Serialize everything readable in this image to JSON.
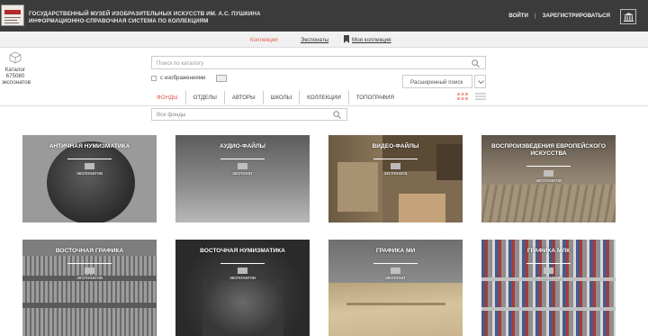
{
  "header": {
    "title_line1": "ГОСУДАРСТВЕННЫЙ МУЗЕЙ ИЗОБРАЗИТЕЛЬНЫХ ИСКУССТВ ИМ. А.С. ПУШКИНА",
    "title_line2": "ИНФОРМАЦИОННО-СПРАВОЧНАЯ СИСТЕМА ПО КОЛЛЕКЦИЯМ",
    "login": "ВОЙТИ",
    "separator": "|",
    "register": "ЗАРЕГИСТРИРОВАТЬСЯ"
  },
  "subnav": {
    "collections": "Коллекции",
    "exhibitions": "Экспонаты",
    "my_collection": "Моя коллекция"
  },
  "catalog": {
    "label": "Каталог",
    "count": "675080",
    "unit": "экспонатов"
  },
  "search": {
    "placeholder": "Поиск по каталогу",
    "with_images": "с изображениями",
    "advanced": "Расширенный поиск"
  },
  "tabs": [
    "ФОНДЫ",
    "ОТДЕЛЫ",
    "АВТОРЫ",
    "ШКОЛЫ",
    "КОЛЛЕКЦИИ",
    "ТОПОГРАФИЯ"
  ],
  "fonds_select": {
    "placeholder": "Все фонды"
  },
  "cards": [
    {
      "title": "АНТИЧНАЯ НУМИЗМАТИКА",
      "count_label": "экспонатов"
    },
    {
      "title": "АУДИО-ФАЙЛЫ",
      "count_label": "экспонат"
    },
    {
      "title": "ВИДЕО-ФАЙЛЫ",
      "count_label": "экспоната"
    },
    {
      "title": "ВОСПРОИЗВЕДЕНИЯ ЕВРОПЕЙСКОГО ИСКУССТВА",
      "count_label": "экспонатов"
    },
    {
      "title": "ВОСТОЧНАЯ ГРАФИКА",
      "count_label": "экспонатов"
    },
    {
      "title": "ВОСТОЧНАЯ НУМИЗМАТИКА",
      "count_label": "экспонатов"
    },
    {
      "title": "ГРАФИКА МИ",
      "count_label": "экспонат"
    },
    {
      "title": "ГРАФИКА МЛК",
      "count_label": "экспонатов"
    }
  ],
  "colors": {
    "header_bg": "#3b3b3b",
    "accent": "#e05a4c",
    "subnav_bg": "#f1f1f1"
  }
}
